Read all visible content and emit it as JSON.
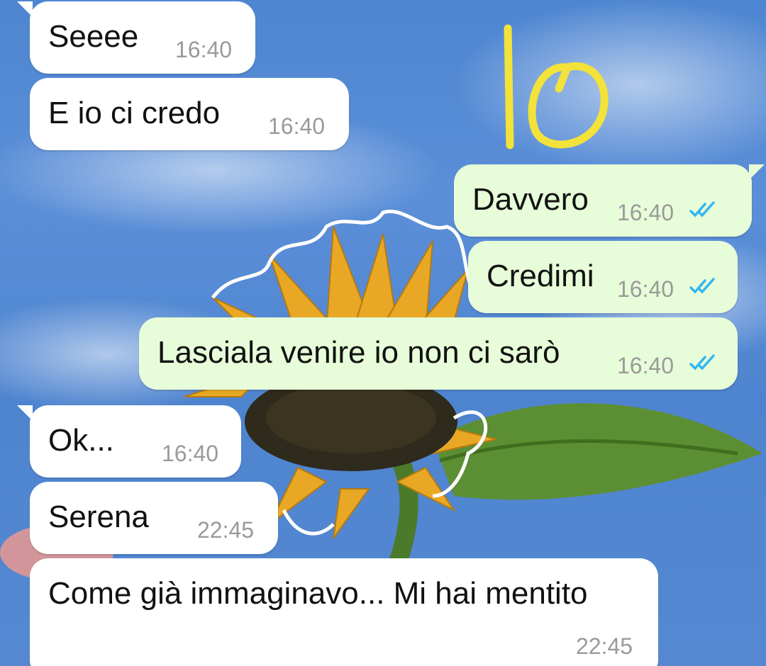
{
  "annotation": {
    "text": "Io",
    "color": "#f2e23a"
  },
  "colors": {
    "incoming_bubble": "#ffffff",
    "outgoing_bubble": "#e7fcd8",
    "read_ticks": "#34b7f1",
    "timestamp": "#9a9a9a"
  },
  "messages": [
    {
      "direction": "in",
      "text": "Seeee",
      "time": "16:40"
    },
    {
      "direction": "in",
      "text": "E io ci credo",
      "time": "16:40"
    },
    {
      "direction": "out",
      "text": "Davvero",
      "time": "16:40",
      "status": "read"
    },
    {
      "direction": "out",
      "text": "Credimi",
      "time": "16:40",
      "status": "read"
    },
    {
      "direction": "out",
      "text": "Lasciala venire io non ci sarò",
      "time": "16:40",
      "status": "read"
    },
    {
      "direction": "in",
      "text": "Ok...",
      "time": "16:40"
    },
    {
      "direction": "in",
      "text": "Serena",
      "time": "22:45"
    },
    {
      "direction": "in",
      "text": "Come già immaginavo... Mi hai mentito",
      "time": "22:45"
    }
  ]
}
